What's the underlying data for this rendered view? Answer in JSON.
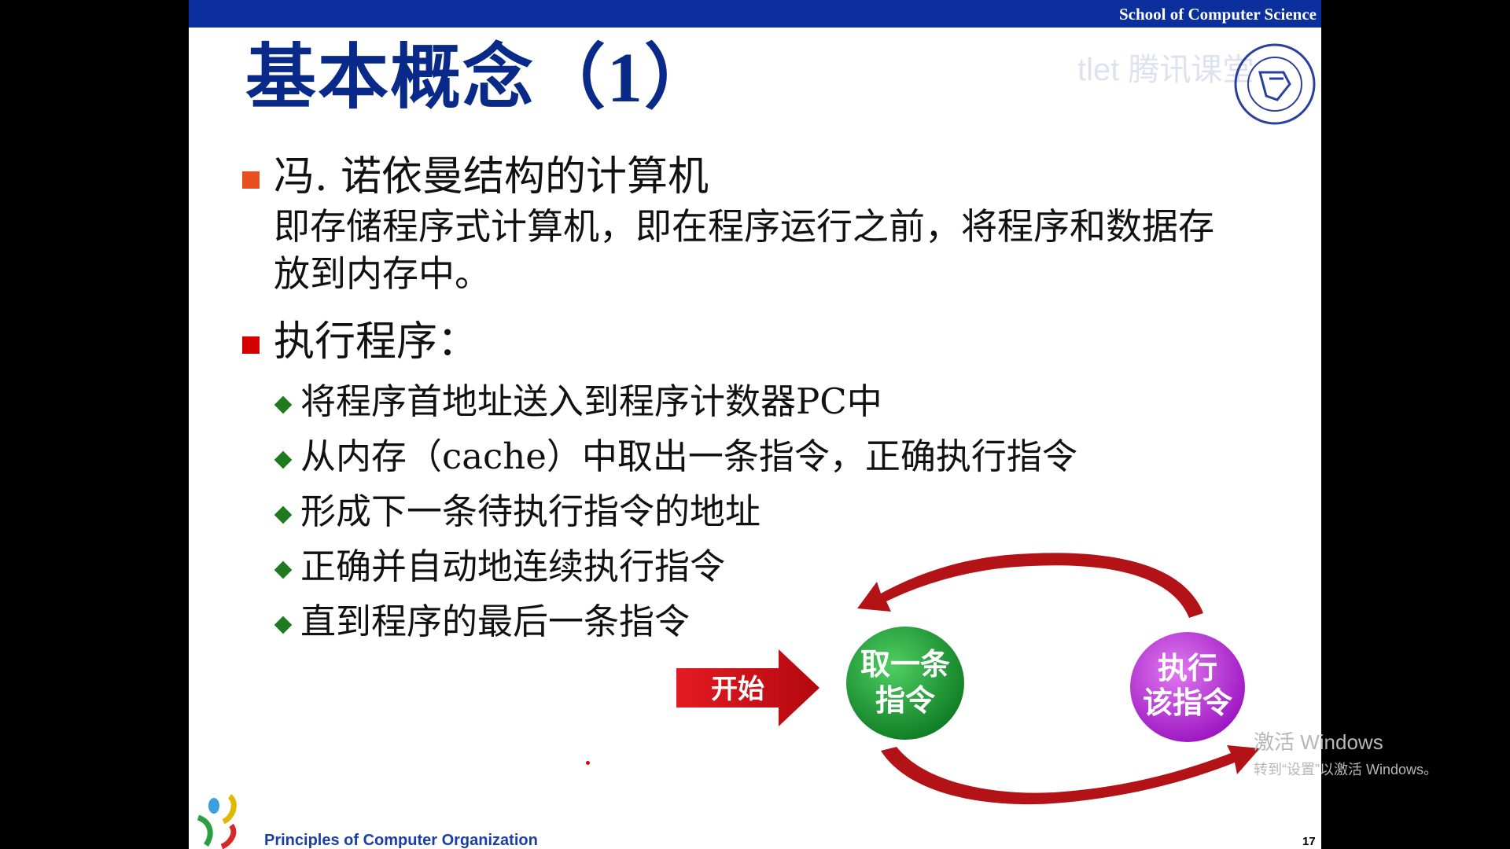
{
  "slide": {
    "header": "School of Computer Science",
    "title": "基本概念（1）",
    "watermark": "tlet 腾讯课堂",
    "bullets": [
      {
        "text": "冯. 诺依曼结构的计算机",
        "color": "#e8501f"
      },
      {
        "text": "执行程序：",
        "color": "#d40000"
      }
    ],
    "description_lines": [
      "即存储程序式计算机，即在程序运行之前，将程序和数据存",
      "放到内存中。"
    ],
    "steps": [
      "将程序首地址送入到程序计数器PC中",
      "从内存（cache）中取出一条指令，正确执行指令",
      "形成下一条待执行指令的地址",
      "正确并自动地连续执行指令",
      "直到程序的最后一条指令"
    ],
    "flow": {
      "start_label": "开始",
      "fetch_label_line1": "取一条",
      "fetch_label_line2": "指令",
      "exec_label_line1": "执行",
      "exec_label_line2": "该指令",
      "colors": {
        "start": "#d3141b",
        "fetch": "#0f8f2a",
        "exec": "#b31ed9",
        "arrows": "#b31217"
      }
    },
    "footer": "Principles of Computer Organization",
    "page_number": "17"
  },
  "os_watermark": {
    "line1": "激活 Windows",
    "line2": "转到“设置”以激活 Windows。"
  }
}
